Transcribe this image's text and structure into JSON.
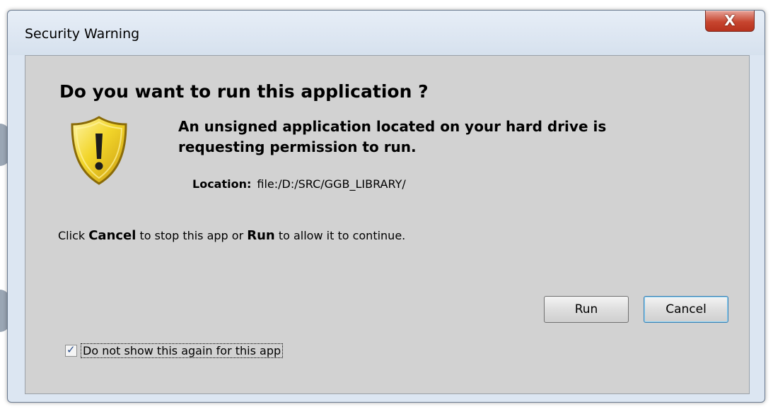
{
  "dialog": {
    "title": "Security Warning",
    "close_glyph": "X",
    "question": "Do you want to run this application ?",
    "message_line1": "An unsigned application located on your hard drive is",
    "message_line2": "requesting permission to run.",
    "location_label": "Location:",
    "location_value": "file:/D:/SRC/GGB_LIBRARY/",
    "instruction": {
      "prefix": "Click ",
      "cancel_word": "Cancel",
      "middle": " to stop this app or ",
      "run_word": "Run",
      "suffix": " to allow it to continue."
    },
    "buttons": {
      "run": "Run",
      "cancel": "Cancel"
    },
    "checkbox": {
      "label": "Do not show this again for this app",
      "checked": true
    },
    "icon": "warning-shield-icon",
    "colors": {
      "shield_yellow": "#f2d52a",
      "close_red": "#c7452f"
    }
  }
}
